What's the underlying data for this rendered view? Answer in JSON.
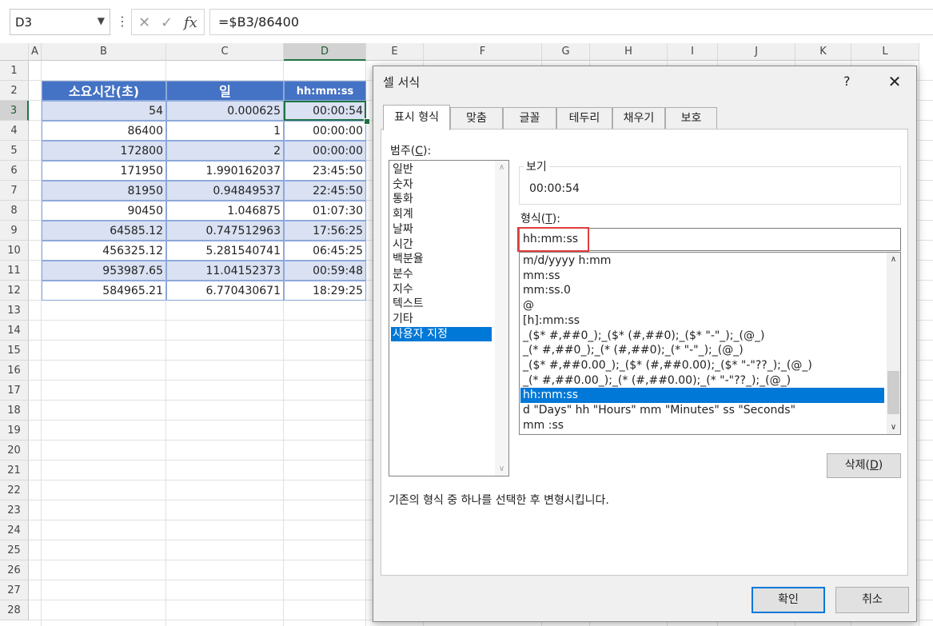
{
  "formula_bar": {
    "name_box": "D3",
    "formula": "=$B3/86400",
    "icons": [
      "vertical-dots-icon",
      "cancel-x-icon",
      "enter-check-icon",
      "fx-icon"
    ]
  },
  "columns": [
    "A",
    "B",
    "C",
    "D",
    "E",
    "F",
    "G",
    "H",
    "I",
    "J",
    "K",
    "L"
  ],
  "rows": [
    "1",
    "2",
    "3",
    "4",
    "5",
    "6",
    "7",
    "8",
    "9",
    "10",
    "11",
    "12",
    "13",
    "14",
    "15",
    "16",
    "17",
    "18",
    "19",
    "20",
    "21",
    "22",
    "23",
    "24",
    "25",
    "26",
    "27",
    "28"
  ],
  "table": {
    "headers": [
      "소요시간(초)",
      "일",
      "hh:mm:ss"
    ],
    "rows": [
      [
        "54",
        "0.000625",
        "00:00:54"
      ],
      [
        "86400",
        "1",
        "00:00:00"
      ],
      [
        "172800",
        "2",
        "00:00:00"
      ],
      [
        "171950",
        "1.990162037",
        "23:45:50"
      ],
      [
        "81950",
        "0.94849537",
        "22:45:50"
      ],
      [
        "90450",
        "1.046875",
        "01:07:30"
      ],
      [
        "64585.12",
        "0.747512963",
        "17:56:25"
      ],
      [
        "456325.12",
        "5.281540741",
        "06:45:25"
      ],
      [
        "953987.65",
        "11.04152373",
        "00:59:48"
      ],
      [
        "584965.21",
        "6.770430671",
        "18:29:25"
      ]
    ]
  },
  "dialog": {
    "title": "셀 서식",
    "help": "?",
    "close": "✕",
    "tabs": [
      "표시 형식",
      "맞춤",
      "글꼴",
      "테두리",
      "채우기",
      "보호"
    ],
    "category_label": "범주(",
    "category_key": "C",
    "category_label_end": "):",
    "categories": [
      "일반",
      "숫자",
      "통화",
      "회계",
      "날짜",
      "시간",
      "백분율",
      "분수",
      "지수",
      "텍스트",
      "기타",
      "사용자 지정"
    ],
    "sample_label": "보기",
    "sample_value": "00:00:54",
    "format_label": "형식(",
    "format_key": "T",
    "format_label_end": "):",
    "format_value": "hh:mm:ss",
    "formats": [
      "m/d/yyyy h:mm",
      "mm:ss",
      "mm:ss.0",
      "@",
      "[h]:mm:ss",
      "_($* #,##0_);_($* (#,##0);_($* \"-\"_);_(@_)",
      "_(* #,##0_);_(* (#,##0);_(* \"-\"_);_(@_)",
      "_($* #,##0.00_);_($* (#,##0.00);_($* \"-\"??_);_(@_)",
      "_(* #,##0.00_);_(* (#,##0.00);_(* \"-\"??_);_(@_)",
      "hh:mm:ss",
      "d \"Days\" hh \"Hours\" mm \"Minutes\" ss \"Seconds\"",
      "mm :ss"
    ],
    "delete_label": "삭제(",
    "delete_key": "D",
    "delete_label_end": ")",
    "hint": "기존의 형식 중 하나를 선택한 후 변형시킵니다.",
    "ok": "확인",
    "cancel": "취소"
  },
  "colors": {
    "header_fill": "#4472c4",
    "band_fill": "#d9e1f2",
    "active_cell_border": "#217346",
    "selection_blue": "#0078d7",
    "highlight_red": "#e03c3c"
  }
}
